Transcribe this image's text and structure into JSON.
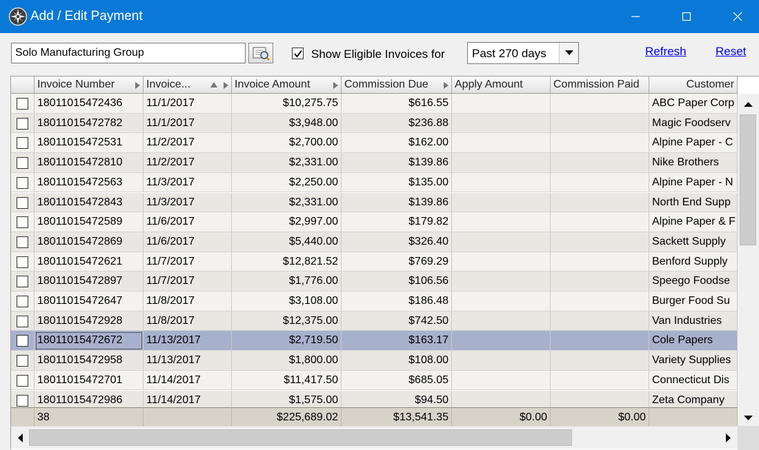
{
  "window": {
    "title": "Add / Edit Payment",
    "icon": "compass-rose-icon"
  },
  "toolbar": {
    "customer_value": "Solo Manufacturing Group",
    "lookup_icon": "search-list-icon",
    "show_eligible_checked": true,
    "show_eligible_label": "Show Eligible Invoices for",
    "period_value": "Past 270 days",
    "refresh_label": "Refresh",
    "reset_label": "Reset"
  },
  "grid": {
    "columns": [
      "Invoice Number",
      "Invoice...",
      "Invoice Amount",
      "Commission Due",
      "Apply Amount",
      "Commission Paid",
      "Customer"
    ],
    "rows": [
      {
        "invoice_number": "18011015472436",
        "invoice_date": "11/1/2017",
        "invoice_amount": "$10,275.75",
        "commission_due": "$616.55",
        "apply_amount": "",
        "commission_paid": "",
        "customer": "ABC Paper Corp"
      },
      {
        "invoice_number": "18011015472782",
        "invoice_date": "11/1/2017",
        "invoice_amount": "$3,948.00",
        "commission_due": "$236.88",
        "apply_amount": "",
        "commission_paid": "",
        "customer": "Magic Foodserv"
      },
      {
        "invoice_number": "18011015472531",
        "invoice_date": "11/2/2017",
        "invoice_amount": "$2,700.00",
        "commission_due": "$162.00",
        "apply_amount": "",
        "commission_paid": "",
        "customer": "Alpine Paper - C"
      },
      {
        "invoice_number": "18011015472810",
        "invoice_date": "11/2/2017",
        "invoice_amount": "$2,331.00",
        "commission_due": "$139.86",
        "apply_amount": "",
        "commission_paid": "",
        "customer": "Nike Brothers"
      },
      {
        "invoice_number": "18011015472563",
        "invoice_date": "11/3/2017",
        "invoice_amount": "$2,250.00",
        "commission_due": "$135.00",
        "apply_amount": "",
        "commission_paid": "",
        "customer": "Alpine Paper - N"
      },
      {
        "invoice_number": "18011015472843",
        "invoice_date": "11/3/2017",
        "invoice_amount": "$2,331.00",
        "commission_due": "$139.86",
        "apply_amount": "",
        "commission_paid": "",
        "customer": "North End Supp"
      },
      {
        "invoice_number": "18011015472589",
        "invoice_date": "11/6/2017",
        "invoice_amount": "$2,997.00",
        "commission_due": "$179.82",
        "apply_amount": "",
        "commission_paid": "",
        "customer": "Alpine Paper & F"
      },
      {
        "invoice_number": "18011015472869",
        "invoice_date": "11/6/2017",
        "invoice_amount": "$5,440.00",
        "commission_due": "$326.40",
        "apply_amount": "",
        "commission_paid": "",
        "customer": "Sackett Supply"
      },
      {
        "invoice_number": "18011015472621",
        "invoice_date": "11/7/2017",
        "invoice_amount": "$12,821.52",
        "commission_due": "$769.29",
        "apply_amount": "",
        "commission_paid": "",
        "customer": "Benford Supply"
      },
      {
        "invoice_number": "18011015472897",
        "invoice_date": "11/7/2017",
        "invoice_amount": "$1,776.00",
        "commission_due": "$106.56",
        "apply_amount": "",
        "commission_paid": "",
        "customer": "Speego Foodse"
      },
      {
        "invoice_number": "18011015472647",
        "invoice_date": "11/8/2017",
        "invoice_amount": "$3,108.00",
        "commission_due": "$186.48",
        "apply_amount": "",
        "commission_paid": "",
        "customer": "Burger Food Su"
      },
      {
        "invoice_number": "18011015472928",
        "invoice_date": "11/8/2017",
        "invoice_amount": "$12,375.00",
        "commission_due": "$742.50",
        "apply_amount": "",
        "commission_paid": "",
        "customer": "Van Industries"
      },
      {
        "invoice_number": "18011015472672",
        "invoice_date": "11/13/2017",
        "invoice_amount": "$2,719.50",
        "commission_due": "$163.17",
        "apply_amount": "",
        "commission_paid": "",
        "customer": "Cole Papers",
        "selected": true
      },
      {
        "invoice_number": "18011015472958",
        "invoice_date": "11/13/2017",
        "invoice_amount": "$1,800.00",
        "commission_due": "$108.00",
        "apply_amount": "",
        "commission_paid": "",
        "customer": "Variety Supplies"
      },
      {
        "invoice_number": "18011015472701",
        "invoice_date": "11/14/2017",
        "invoice_amount": "$11,417.50",
        "commission_due": "$685.05",
        "apply_amount": "",
        "commission_paid": "",
        "customer": "Connecticut Dis"
      },
      {
        "invoice_number": "18011015472986",
        "invoice_date": "11/14/2017",
        "invoice_amount": "$1,575.00",
        "commission_due": "$94.50",
        "apply_amount": "",
        "commission_paid": "",
        "customer": "Zeta Company"
      }
    ],
    "totals": {
      "count": "38",
      "invoice_amount": "$225,689.02",
      "commission_due": "$13,541.35",
      "apply_amount": "$0.00",
      "commission_paid": "$0.00"
    }
  },
  "colors": {
    "titlebar": "#0a78d7",
    "row_odd": "#f3f2ee",
    "row_even": "#e8e7e2",
    "row_selected": "#a8b1cc",
    "footer": "#d8d3c9",
    "link": "#0000ee"
  }
}
